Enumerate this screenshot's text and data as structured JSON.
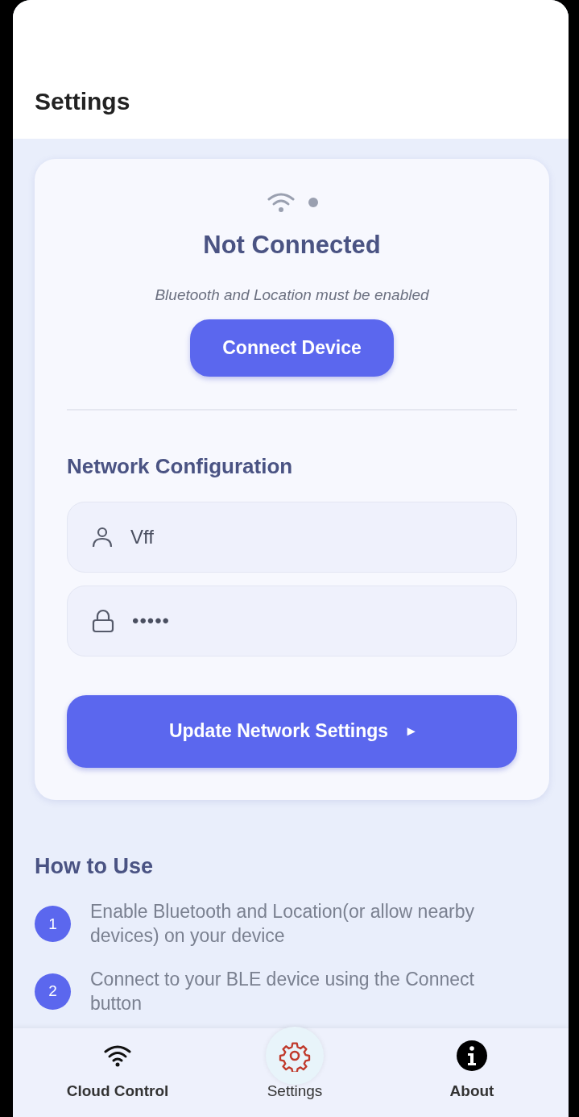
{
  "header": {
    "title": "Settings"
  },
  "device_card": {
    "connected": false,
    "status": "Not Connected",
    "hint": "Bluetooth and Location must be enabled",
    "connect_button": "Connect Device"
  },
  "network": {
    "title": "Network Configuration",
    "fields": [
      {
        "kind": "user",
        "value": "Vff"
      },
      {
        "kind": "password",
        "value": "•••••"
      }
    ],
    "submit_button": "Update Network Settings",
    "submit_arrow": "▸"
  },
  "how_to": {
    "title": "How to Use",
    "steps": [
      {
        "number": "1",
        "text": "Enable Bluetooth and Location(or allow nearby devices) on your device"
      },
      {
        "number": "2",
        "text": "Connect to your BLE device using the Connect button"
      }
    ]
  },
  "bottom_nav": [
    {
      "kind": "wifi",
      "label": "Cloud Control",
      "selected": false
    },
    {
      "kind": "gear",
      "label": "Settings",
      "selected": true
    },
    {
      "kind": "info",
      "label": "About",
      "selected": false
    }
  ]
}
